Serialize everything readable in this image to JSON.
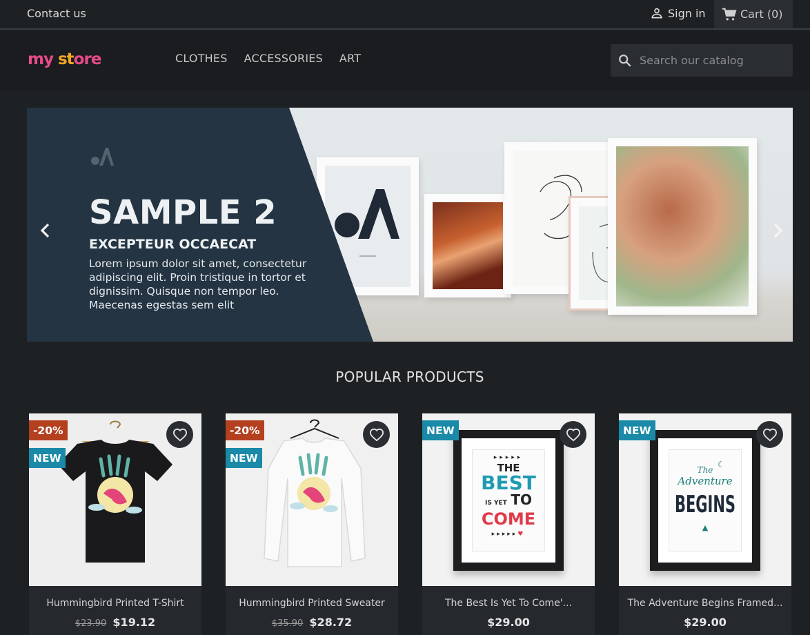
{
  "topbar": {
    "contact": "Contact us",
    "signin": "Sign in",
    "cart_label": "Cart",
    "cart_count": "(0)"
  },
  "header": {
    "logo": [
      "my",
      " ",
      "st",
      "ore"
    ],
    "nav": [
      "CLOTHES",
      "ACCESSORIES",
      "ART"
    ],
    "search_placeholder": "Search our catalog"
  },
  "hero": {
    "title": "SAMPLE 2",
    "subtitle": "EXCEPTEUR OCCAECAT",
    "text": "Lorem ipsum dolor sit amet, consectetur adipiscing elit. Proin tristique in tortor et dignissim. Quisque non tempor leo. Maecenas egestas sem elit"
  },
  "section": {
    "title": "POPULAR PRODUCTS"
  },
  "products": [
    {
      "name": "Hummingbird Printed T-Shirt",
      "old_price": "$23.90",
      "price": "$19.12",
      "discount": "-20%",
      "badge": "NEW"
    },
    {
      "name": "Hummingbird Printed Sweater",
      "old_price": "$35.90",
      "price": "$28.72",
      "discount": "-20%",
      "badge": "NEW"
    },
    {
      "name": "The Best Is Yet To Come'...",
      "old_price": "",
      "price": "$29.00",
      "discount": "",
      "badge": "NEW",
      "poster": [
        "THE",
        "BEST",
        "IS YET",
        "TO",
        "COME"
      ]
    },
    {
      "name": "The Adventure Begins Framed...",
      "old_price": "",
      "price": "$29.00",
      "discount": "",
      "badge": "NEW",
      "poster": [
        "The",
        "Adventure",
        "BEGINS"
      ]
    }
  ],
  "colors": {
    "discount": "#b4401f",
    "new": "#1a8aa8",
    "panel": "#243443"
  }
}
